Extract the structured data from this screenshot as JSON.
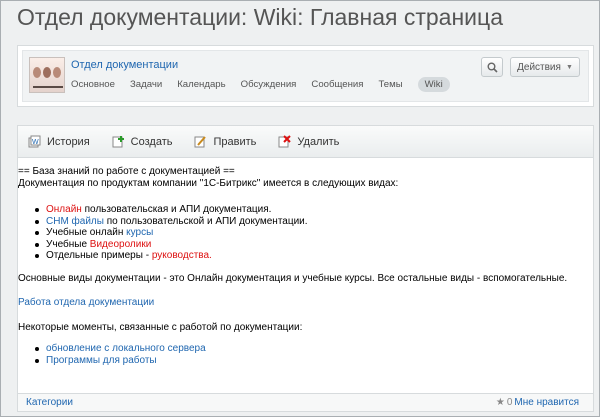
{
  "page": {
    "title": "Отдел документации: Wiki: Главная страница"
  },
  "group": {
    "name": "Отдел документации",
    "nav": [
      "Основное",
      "Задачи",
      "Календарь",
      "Обсуждения",
      "Сообщения",
      "Темы",
      "Wiki"
    ],
    "search_icon": "search-icon",
    "actions_label": "Действия"
  },
  "toolbar": {
    "history": "История",
    "create": "Создать",
    "edit": "Править",
    "delete": "Удалить"
  },
  "article": {
    "heading": "== База знаний по работе с документацией ==",
    "intro": "Документация по продуктам компании \"1С-Битрикс\" имеется в следующих видах:",
    "items": [
      {
        "link": "Онлайн",
        "rest": " пользовательская и АПИ документация."
      },
      {
        "link": "CHM файлы",
        "rest": " по пользовательской и АПИ документации."
      },
      {
        "pre": "Учебные онлайн ",
        "link": "курсы"
      },
      {
        "pre": "Учебные ",
        "link": "Видеоролики"
      },
      {
        "pre": "Отдельные примеры - ",
        "link": "руководства."
      }
    ],
    "summary": "Основные виды документации - это Онлайн документация и учебные курсы. Все остальные виды - вспомогательные.",
    "dept_link": "Работа отдела документации",
    "moments_intro": "Некоторые моменты, связанные с работой по документации:",
    "moments": [
      "обновление с локального сервера",
      "Программы для работы"
    ]
  },
  "footer": {
    "categories": "Категории",
    "rating_count": "0",
    "like": "Мне нравится"
  },
  "colors": {
    "link": "#2067b0",
    "red_link": "#d11111",
    "title": "#555555"
  }
}
